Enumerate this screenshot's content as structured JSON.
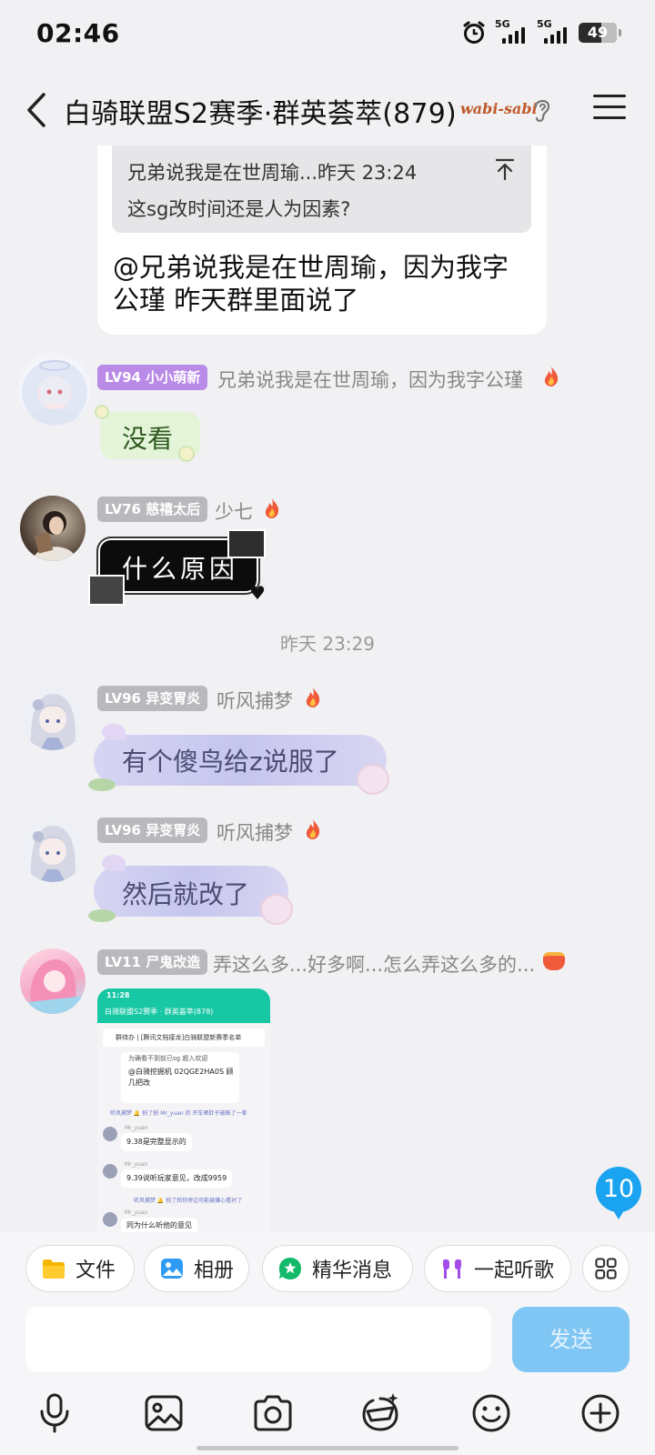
{
  "status_bar": {
    "time": "02:46",
    "network_1": "5G",
    "network_2": "5G",
    "battery": "49"
  },
  "header": {
    "title": "白骑联盟S2赛季·群英荟萃(879)",
    "brand_tag": "wabi-sabi"
  },
  "quoted_message": {
    "sender_time": "兄弟说我是在世周瑜...昨天 23:24",
    "text": "这sg改时间还是人为因素?",
    "reply": "@兄弟说我是在世周瑜，因为我字公瑾 昨天群里面说了"
  },
  "messages": [
    {
      "level": "LV94 小小萌新",
      "name": "兄弟说我是在世周瑜，因为我字公瑾",
      "text": "没看",
      "badge_color": "#b98ae6"
    },
    {
      "level": "LV76 慈禧太后",
      "name": "少七",
      "text": "什么原因",
      "badge_color": "#b9b9bd"
    },
    {
      "level": "LV96 异变胃炎",
      "name": "听风捕梦",
      "text": "有个傻鸟给z说服了",
      "badge_color": "#b9b9bd"
    },
    {
      "level": "LV96 异变胃炎",
      "name": "听风捕梦",
      "text": "然后就改了",
      "badge_color": "#b9b9bd"
    },
    {
      "level": "LV11 尸鬼改造",
      "name": "弄这么多...好多啊...怎么弄这么多的...",
      "badge_color": "#b9b9bd"
    }
  ],
  "timestamp": "昨天 23:29",
  "screenshot_msg": {
    "time": "11:28",
    "title": "白骑联盟S2赛季 · 群英荟萃(878)",
    "todo": "群待办 | [腾讯文档接龙]白骑联盟新赛季名单",
    "welcome": "为确看不到前已sg 超入欢迎",
    "line1": "@白骑挖掘机  02QGE2HA0S 顾几把改",
    "notice1": "听风捕梦 🔔 拍了拍 Mr_yuan 的 开车晒肚子被蛛了一拳",
    "u1": "Mr_yuan",
    "m1": "9.38是完整显示的",
    "u2": "Mr_yuan",
    "m2": "9.39说听玩家意见，改成9959",
    "notice2": "听风捕梦 🔔 拍了拍你旁边可能被嫌心看衬了",
    "u3": "Mr_yuan",
    "m3": "同为什么听他的意见"
  },
  "unread_count": "10",
  "quick_actions": [
    "文件",
    "相册",
    "精华消息",
    "一起听歌"
  ],
  "send_label": "发送",
  "icons": {
    "back": "chevron-left-icon",
    "ear": "ear-icon",
    "menu": "hamburger-icon",
    "fire": "fire-icon",
    "mic": "microphone-icon",
    "image": "image-icon",
    "camera": "camera-icon",
    "sticker": "sticker-icon",
    "emoji": "emoji-icon",
    "plus": "plus-icon"
  }
}
